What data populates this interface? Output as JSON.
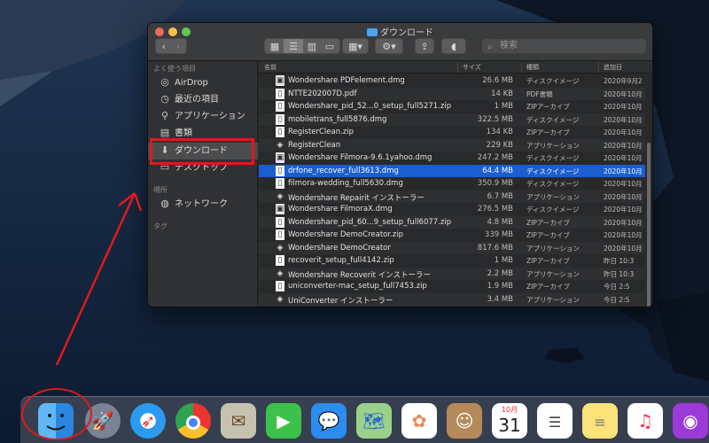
{
  "window": {
    "title": "ダウンロード",
    "search_placeholder": "検索"
  },
  "sidebar": {
    "favorites_header": "よく使う項目",
    "places_header": "場所",
    "tags_header": "タグ",
    "items": [
      {
        "label": "AirDrop",
        "icon": "airdrop-icon"
      },
      {
        "label": "最近の項目",
        "icon": "recents-icon"
      },
      {
        "label": "アプリケーション",
        "icon": "applications-icon"
      },
      {
        "label": "書類",
        "icon": "documents-icon"
      },
      {
        "label": "ダウンロード",
        "icon": "downloads-icon"
      },
      {
        "label": "デスクトップ",
        "icon": "desktop-icon"
      }
    ],
    "places": [
      {
        "label": "ネットワーク",
        "icon": "network-icon"
      }
    ]
  },
  "columns": {
    "name": "名前",
    "size": "サイズ",
    "kind": "種類",
    "date": "追加日"
  },
  "files": [
    {
      "name": "Wondershare PDFelement.dmg",
      "size": "26.6 MB",
      "kind": "ディスクイメージ",
      "date": "2020年9月2",
      "icon": "dmg"
    },
    {
      "name": "NTTE202007D.pdf",
      "size": "14 KB",
      "kind": "PDF書類",
      "date": "2020年10月",
      "icon": "doc"
    },
    {
      "name": "Wondershare_pid_52...0_setup_full5271.zip",
      "size": "1 MB",
      "kind": "ZIPアーカイブ",
      "date": "2020年10月",
      "icon": "doc"
    },
    {
      "name": "mobiletrans_full5876.dmg",
      "size": "322.5 MB",
      "kind": "ディスクイメージ",
      "date": "2020年10月",
      "icon": "doc"
    },
    {
      "name": "RegisterClean.zip",
      "size": "134 KB",
      "kind": "ZIPアーカイブ",
      "date": "2020年10月",
      "icon": "doc"
    },
    {
      "name": "RegisterClean",
      "size": "229 KB",
      "kind": "アプリケーション",
      "date": "2020年10月",
      "icon": "app"
    },
    {
      "name": "Wondershare Filmora-9.6.1yahoo.dmg",
      "size": "247.2 MB",
      "kind": "ディスクイメージ",
      "date": "2020年10月",
      "icon": "dmg"
    },
    {
      "name": "drfone_recover_full3613.dmg",
      "size": "64.4 MB",
      "kind": "ディスクイメージ",
      "date": "2020年10月",
      "icon": "doc",
      "selected": true
    },
    {
      "name": "filmora-wedding_full5630.dmg",
      "size": "350.9 MB",
      "kind": "ディスクイメージ",
      "date": "2020年10月",
      "icon": "doc"
    },
    {
      "name": "Wondershare Repairit インストーラー",
      "size": "6.7 MB",
      "kind": "アプリケーション",
      "date": "2020年10月",
      "icon": "app"
    },
    {
      "name": "Wondershare FilmoraX.dmg",
      "size": "276.5 MB",
      "kind": "ディスクイメージ",
      "date": "2020年10月",
      "icon": "dmg"
    },
    {
      "name": "Wondershare_pid_60...9_setup_full6077.zip",
      "size": "4.8 MB",
      "kind": "ZIPアーカイブ",
      "date": "2020年10月",
      "icon": "doc"
    },
    {
      "name": "Wondershare DemoCreator.zip",
      "size": "339 MB",
      "kind": "ZIPアーカイブ",
      "date": "2020年10月",
      "icon": "doc"
    },
    {
      "name": "Wondershare DemoCreator",
      "size": "817.6 MB",
      "kind": "アプリケーション",
      "date": "2020年10月",
      "icon": "app"
    },
    {
      "name": "recoverit_setup_full4142.zip",
      "size": "1 MB",
      "kind": "ZIPアーカイブ",
      "date": "昨日 10:3",
      "icon": "doc"
    },
    {
      "name": "Wondershare Recoverit インストーラー",
      "size": "2.2 MB",
      "kind": "アプリケーション",
      "date": "昨日 10:3",
      "icon": "app"
    },
    {
      "name": "uniconverter-mac_setup_full7453.zip",
      "size": "1.9 MB",
      "kind": "ZIPアーカイブ",
      "date": "今日 2:5",
      "icon": "doc"
    },
    {
      "name": "UniConverter インストーラー",
      "size": "3.4 MB",
      "kind": "アプリケーション",
      "date": "今日 2:5",
      "icon": "app"
    }
  ],
  "dock": {
    "calendar_month": "10月",
    "calendar_day": "31",
    "apps": [
      "finder",
      "launchpad",
      "safari",
      "chrome",
      "mail",
      "facetime",
      "messages",
      "maps",
      "photos",
      "contacts",
      "calendar",
      "reminders",
      "notes",
      "music",
      "podcasts"
    ]
  },
  "colors": {
    "annotation_red": "#e01a1a",
    "selection_blue": "#1a5ecf"
  }
}
